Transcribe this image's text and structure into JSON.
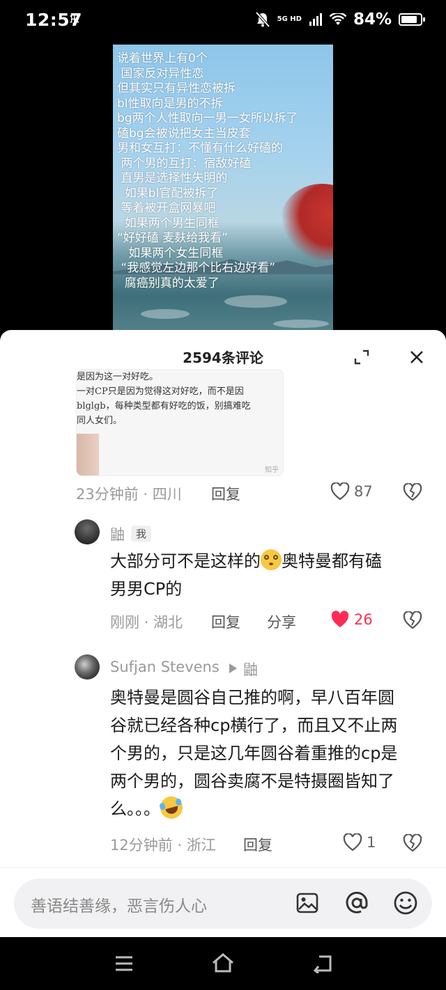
{
  "status_bar": {
    "time": "12:57",
    "network_top": "5G HD",
    "network_bottom": "",
    "battery": "84%",
    "battery_level": 0.84
  },
  "video": {
    "caption_lines": [
      "说着世界上有0个",
      " 国家反对异性恋",
      "但其实只有异性恋被拆",
      "bl性取向是男的不拆",
      "bg两个人性取向一男一女所以拆了",
      "磕bg会被说把女主当皮套",
      "男和女互打：不懂有什么好磕的",
      " 两个男的互打：宿敌好磕",
      " 直男是选择性失明的",
      "  如果bl官配被拆了",
      " 等着被开盒网暴吧",
      "  如果两个男生同框",
      "“好好磕 麦麸给我看”",
      "   如果两个女生同框",
      " “我感觉左边那个比右边好看”",
      "  腐癌别真的太爱了"
    ]
  },
  "comments_panel": {
    "title": "2594条评论",
    "image_text_lines": [
      "是因为这一对好吃。",
      "一对CP只是因为觉得这对好吃，而不是因",
      "blglgb，每种类型都有好吃的饭，别搞难吃",
      "同人女们。"
    ],
    "image_watermark": "知乎",
    "comments": [
      {
        "meta": "23分钟前 · 四川",
        "reply_label": "回复",
        "likes": "87",
        "liked": false
      },
      {
        "author": "鼬",
        "badge": "我",
        "text_line1_a": "大部分可不是这样的",
        "text_line1_b": "奥特曼都有磕",
        "text_line2": "男男CP的",
        "meta": "刚刚 · 湖北",
        "reply_label": "回复",
        "share_label": "分享",
        "likes": "26",
        "liked": true
      },
      {
        "author": "Sufjan Stevens",
        "reply_to": "鼬",
        "text_lines": [
          "奥特曼是圆谷自己推的啊，早八百年圆",
          "谷就已经各种cp横行了，而且又不止两",
          "个男的，只是这几年圆谷着重推的cp是",
          "两个男的，圆谷卖腐不是特摄圈皆知了"
        ],
        "text_last": "么。。。",
        "meta": "12分钟前 · 浙江",
        "reply_label": "回复",
        "likes": "1",
        "liked": false
      }
    ],
    "input_placeholder": "善语结善缘，恶言伤人心"
  },
  "colors": {
    "accent_like": "#fe2c55",
    "meta_text": "#9a9a9a"
  }
}
